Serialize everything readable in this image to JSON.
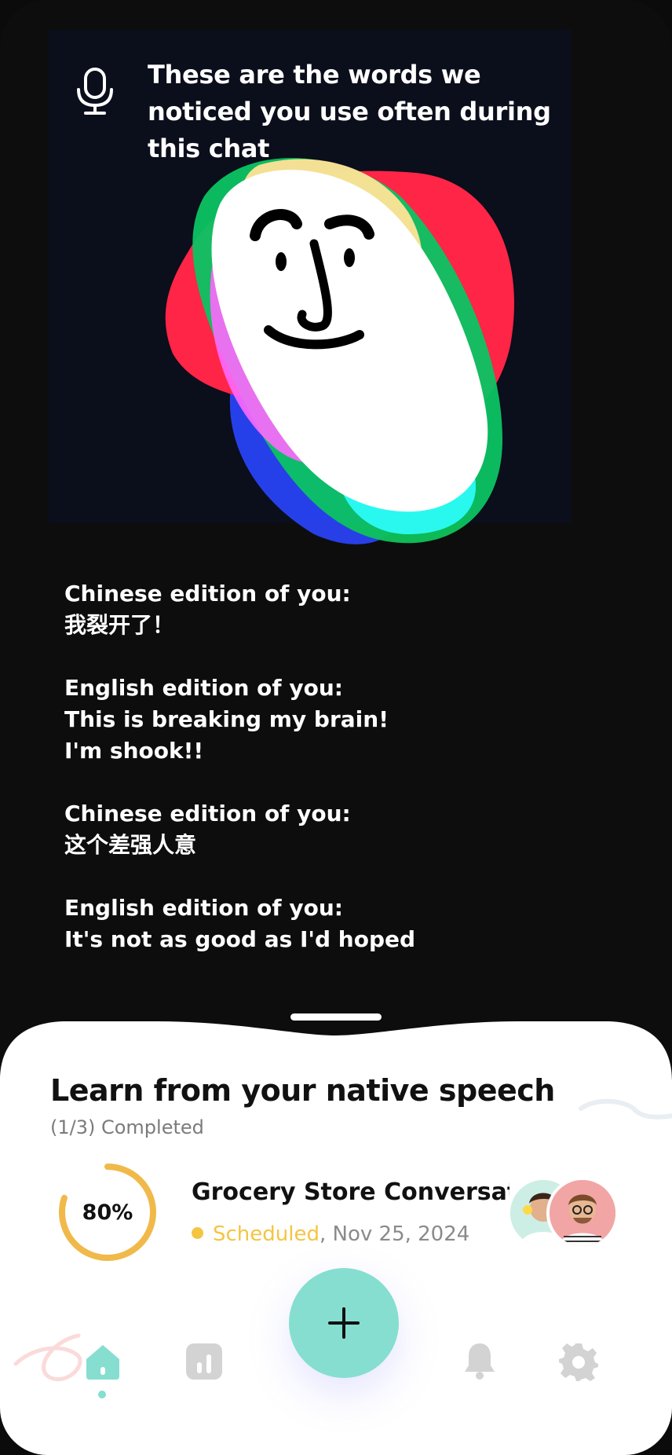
{
  "hero": {
    "title": "These are the words we noticed you use often during this chat",
    "mic_icon": "microphone-icon"
  },
  "transcript": [
    {
      "label": "Chinese edition of you:",
      "lines": [
        "我裂开了！"
      ]
    },
    {
      "label": "English edition of you:",
      "lines": [
        "This is breaking my brain!",
        "I'm shook!!"
      ]
    },
    {
      "label": "Chinese edition of you:",
      "lines": [
        "这个差强人意"
      ]
    },
    {
      "label": "English edition of you:",
      "lines": [
        "It's not as good as I'd hoped"
      ]
    }
  ],
  "sheet": {
    "title": "Learn from your native speech",
    "subtitle": "(1/3) Completed"
  },
  "conversation": {
    "progress_label": "80%",
    "progress_value": 0.8,
    "title": "Grocery Store Conversation",
    "status": "Scheduled",
    "date": ", Nov 25, 2024"
  },
  "nav": {
    "items": [
      "home-icon",
      "stats-icon",
      "add-icon",
      "bell-icon",
      "gear-icon"
    ],
    "active": "home-icon"
  },
  "colors": {
    "accent": "#86ded1",
    "progress": "#f0b94a",
    "scheduled": "#f4c542"
  }
}
